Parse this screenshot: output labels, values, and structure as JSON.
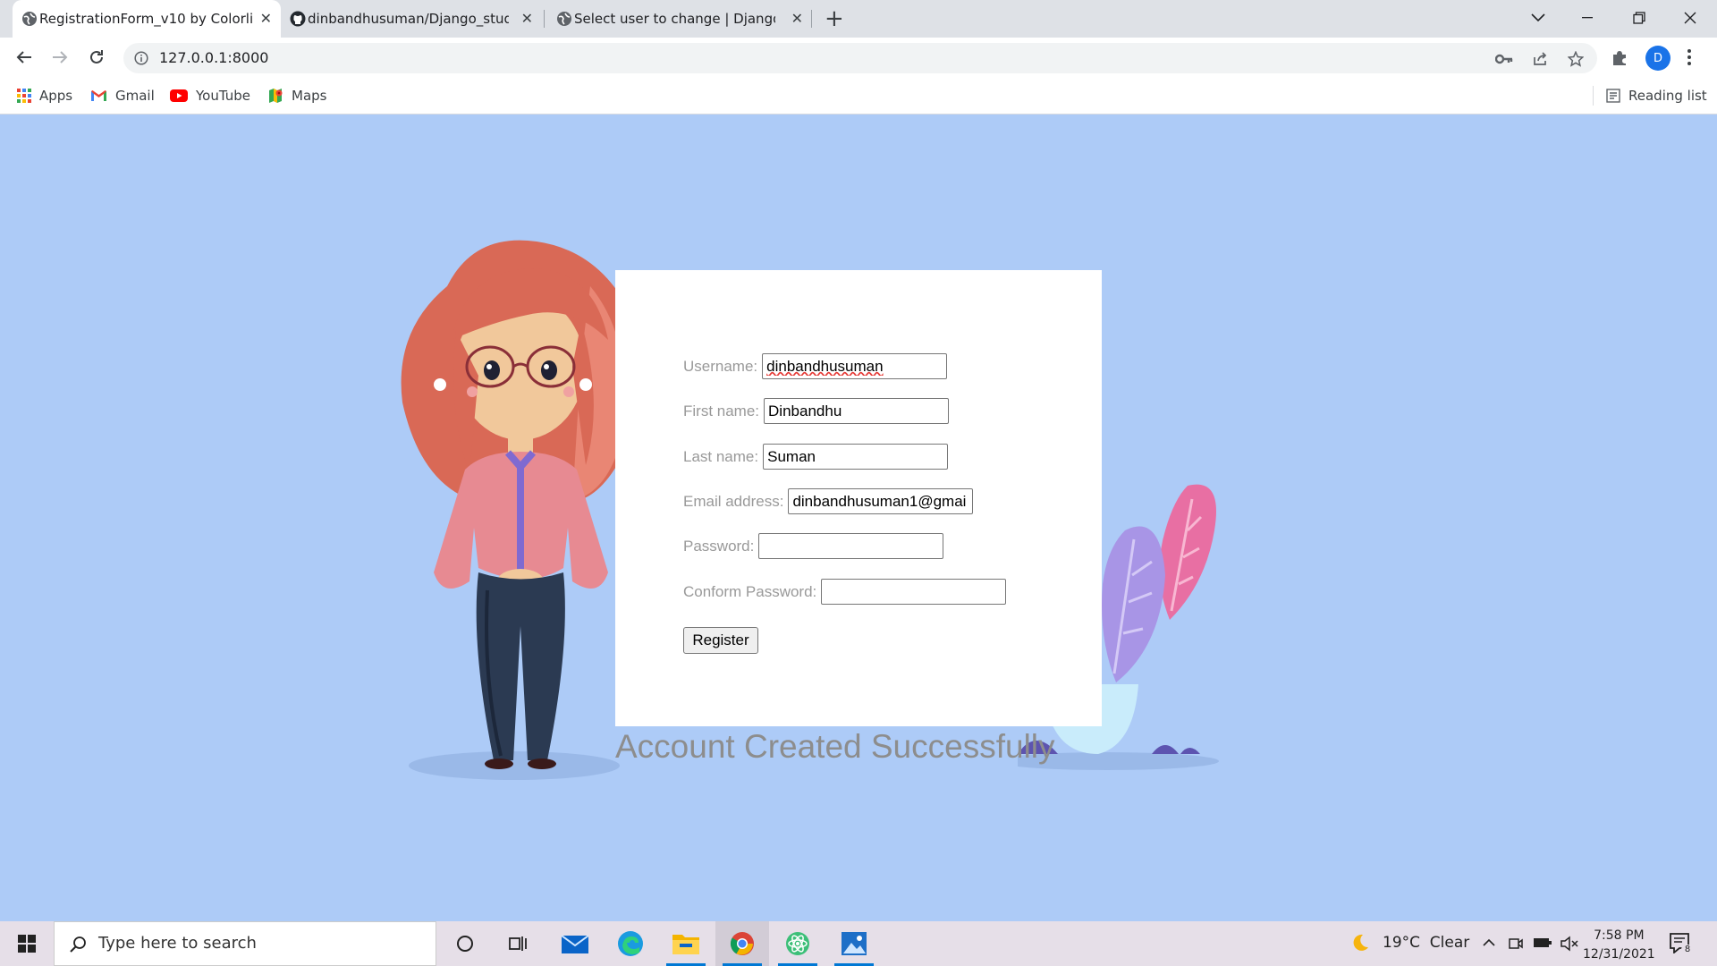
{
  "browser": {
    "tabs": [
      {
        "title": "RegistrationForm_v10 by Colorlib",
        "active": true,
        "icon": "globe-icon"
      },
      {
        "title": "dinbandhusuman/Django_studen",
        "active": false,
        "icon": "github-icon"
      },
      {
        "title": "Select user to change | Django si",
        "active": false,
        "icon": "globe-icon"
      }
    ],
    "url": "127.0.0.1:8000",
    "profile_initial": "D",
    "bookmarks": [
      {
        "label": "Apps",
        "icon": "apps-grid-icon"
      },
      {
        "label": "Gmail",
        "icon": "gmail-icon"
      },
      {
        "label": "YouTube",
        "icon": "youtube-icon"
      },
      {
        "label": "Maps",
        "icon": "maps-icon"
      }
    ],
    "reading_list": "Reading list"
  },
  "form": {
    "fields": [
      {
        "label": "Username:",
        "value": "dinbandhusuman",
        "type": "text"
      },
      {
        "label": "First name:",
        "value": "Dinbandhu",
        "type": "text"
      },
      {
        "label": "Last name:",
        "value": "Suman",
        "type": "text"
      },
      {
        "label": "Email address:",
        "value": "dinbandhusuman1@gmai",
        "type": "email"
      },
      {
        "label": "Password:",
        "value": "",
        "type": "password"
      },
      {
        "label": "Conform Password:",
        "value": "",
        "type": "password"
      }
    ],
    "submit_label": "Register"
  },
  "message": "Account Created Successfully",
  "taskbar": {
    "search_placeholder": "Type here to search",
    "weather": "19°C  Clear",
    "time": "7:58 PM",
    "date": "12/31/2021",
    "notification_count": "8"
  },
  "colors": {
    "page_background": "#adcbf7",
    "card_background": "#ffffff",
    "label_text": "#999999",
    "message_text": "#8d8d8d"
  }
}
